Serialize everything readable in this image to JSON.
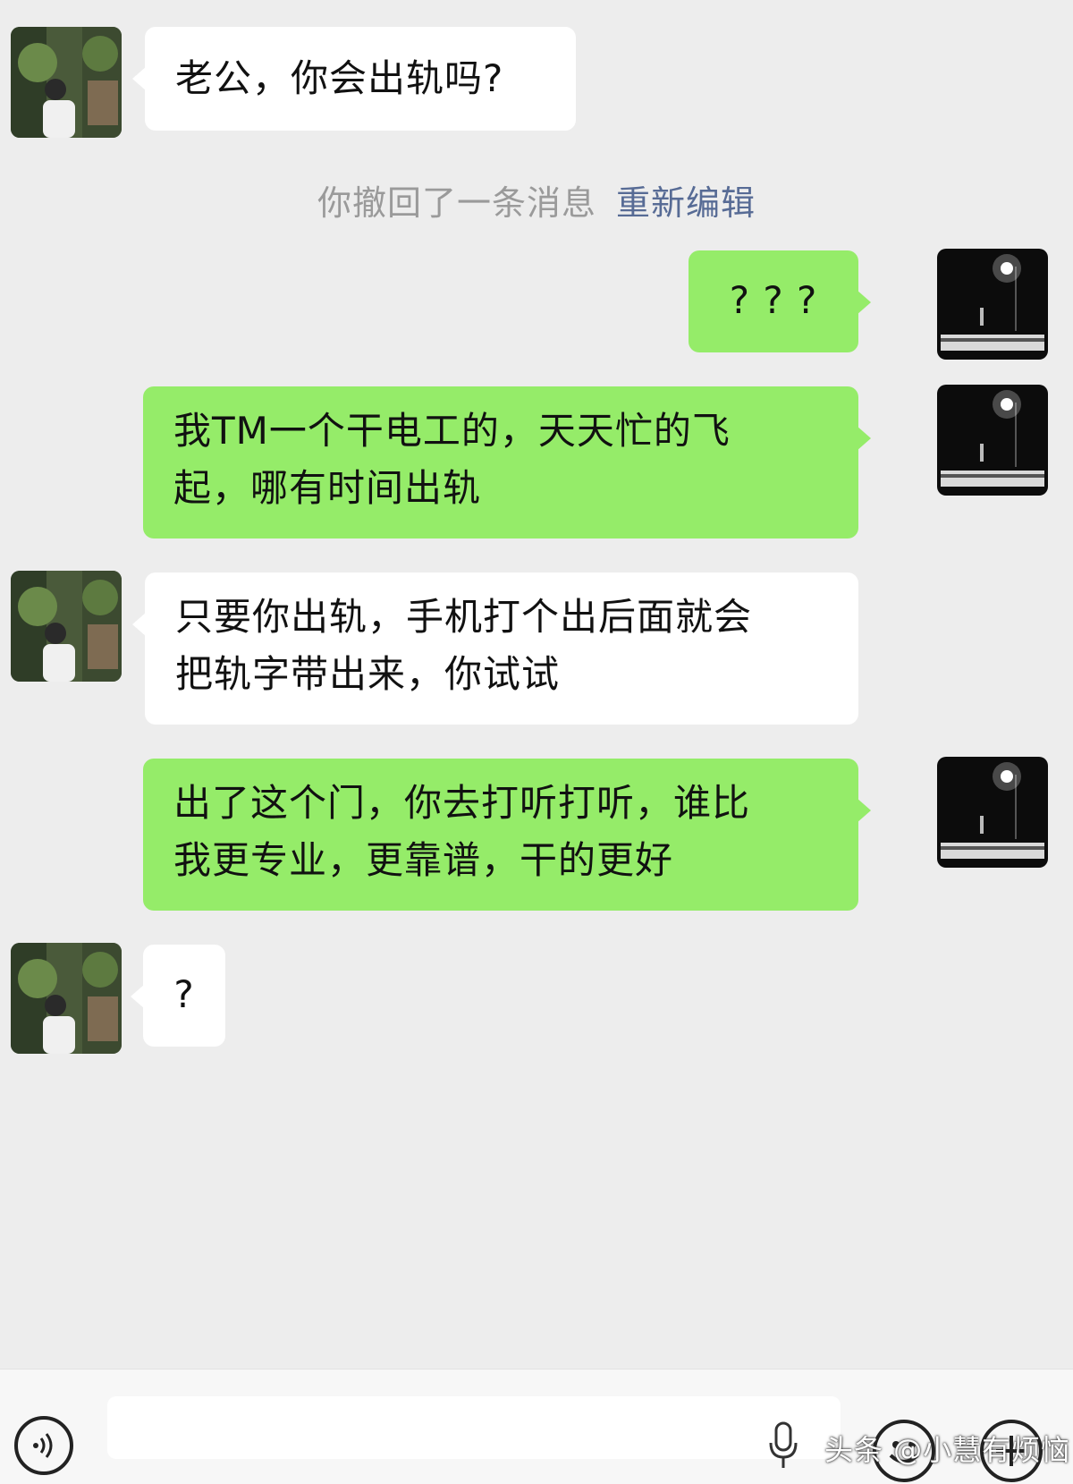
{
  "colors": {
    "background": "#ededed",
    "bubble_received": "#ffffff",
    "bubble_sent": "#95ec69",
    "system_text": "#9a9a9a",
    "link": "#576b95"
  },
  "messages": [
    {
      "side": "left",
      "text": "老公，你会出轨吗?"
    },
    {
      "side": "right",
      "text": "? ? ?"
    },
    {
      "side": "right",
      "lines": [
        "我TM一个干电工的，天天忙的飞",
        "起，哪有时间出轨"
      ]
    },
    {
      "side": "left",
      "lines": [
        "只要你出轨，手机打个出后面就会",
        "把轨字带出来，你试试"
      ]
    },
    {
      "side": "right",
      "lines": [
        "出了这个门，你去打听打听，谁比",
        "我更专业，更靠谱，干的更好"
      ]
    },
    {
      "side": "left",
      "text": "?"
    }
  ],
  "system_notice": {
    "text": "你撤回了一条消息",
    "link": "重新编辑"
  },
  "toolbar": {
    "voice_icon": "voice-icon",
    "mic_icon": "mic-icon",
    "emoji_icon": "emoji-icon",
    "plus_icon": "plus-icon"
  },
  "watermark": "头条 @小慧有烦恼"
}
